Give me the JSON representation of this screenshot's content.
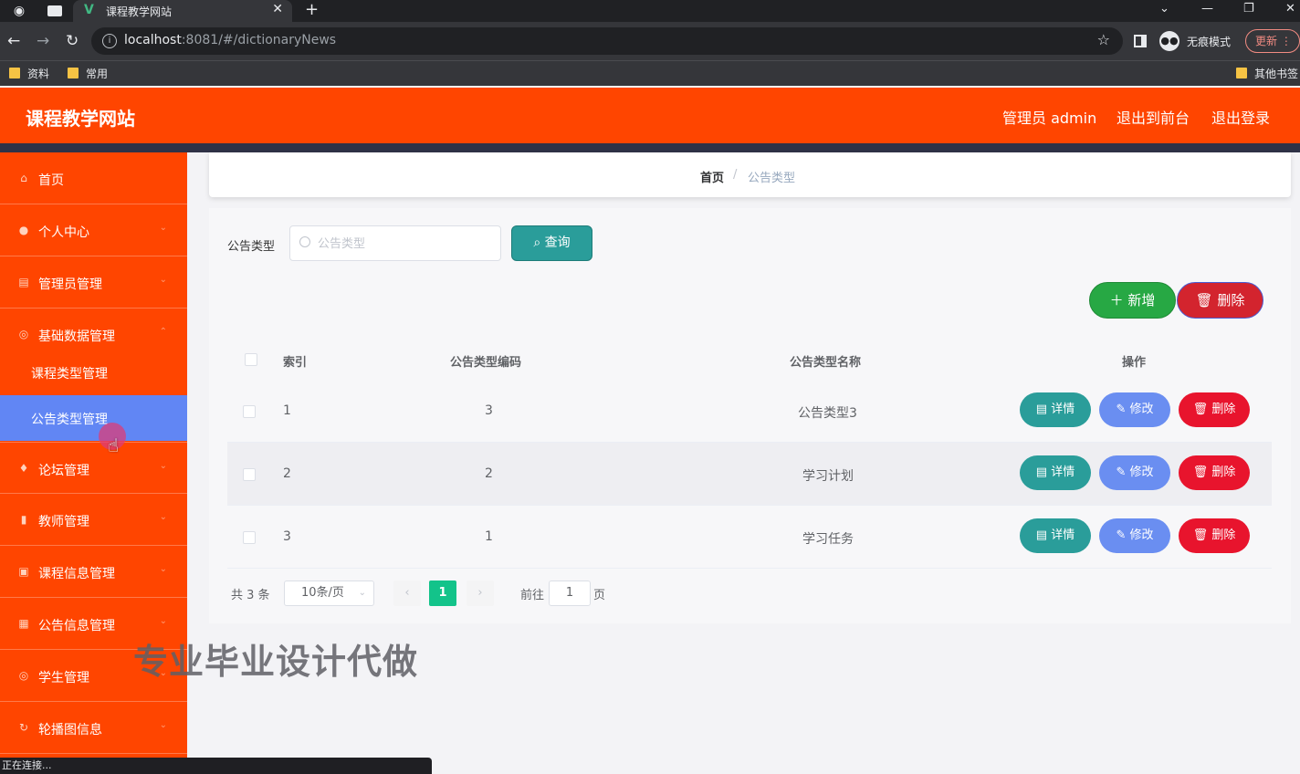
{
  "browser": {
    "tab_title": "课程教学网站",
    "url_host": "localhost",
    "url_rest": ":8081/#/dictionaryNews",
    "incognito_label": "无痕模式",
    "update_label": "更新",
    "bookmarks": [
      "资料",
      "常用",
      "其他书签"
    ],
    "status_text": "正在连接..."
  },
  "header": {
    "brand": "课程教学网站",
    "admin": "管理员 admin",
    "to_front": "退出到前台",
    "logout": "退出登录"
  },
  "sidebar": {
    "items": [
      {
        "label": "首页",
        "icon": "home-icon"
      },
      {
        "label": "个人中心",
        "icon": "user-icon"
      },
      {
        "label": "管理员管理",
        "icon": "doc-icon"
      },
      {
        "label": "基础数据管理",
        "icon": "compass-icon"
      },
      {
        "label": "论坛管理",
        "icon": "pin-icon"
      },
      {
        "label": "教师管理",
        "icon": "chart-icon"
      },
      {
        "label": "课程信息管理",
        "icon": "folder-icon"
      },
      {
        "label": "公告信息管理",
        "icon": "printer-icon"
      },
      {
        "label": "学生管理",
        "icon": "compass-icon"
      },
      {
        "label": "轮播图信息",
        "icon": "refresh-icon"
      }
    ],
    "subitems": [
      "课程类型管理",
      "公告类型管理"
    ]
  },
  "breadcrumb": {
    "home": "首页",
    "separator": "/",
    "current": "公告类型"
  },
  "search": {
    "label": "公告类型",
    "placeholder": "公告类型",
    "button": "查询"
  },
  "actions": {
    "add": "新增",
    "delete": "删除"
  },
  "table": {
    "headers": [
      "索引",
      "公告类型编码",
      "公告类型名称",
      "操作"
    ],
    "rows": [
      {
        "index": "1",
        "code": "3",
        "name": "公告类型3"
      },
      {
        "index": "2",
        "code": "2",
        "name": "学习计划"
      },
      {
        "index": "3",
        "code": "1",
        "name": "学习任务"
      }
    ],
    "row_buttons": {
      "detail": "详情",
      "edit": "修改",
      "delete": "删除"
    }
  },
  "pagination": {
    "total": "共 3 条",
    "page_size": "10条/页",
    "current_page": "1",
    "goto_label": "前往",
    "goto_value": "1",
    "page_unit": "页"
  },
  "watermark": "专业毕业设计代做",
  "colors": {
    "header": "#ff4500",
    "sidebar": "#ff4500",
    "active_sub": "#6186f4",
    "query": "#2a9d9a",
    "add": "#27a844",
    "delete": "#e8142d",
    "edit": "#6a8ef1",
    "page_active": "#13c38a"
  }
}
